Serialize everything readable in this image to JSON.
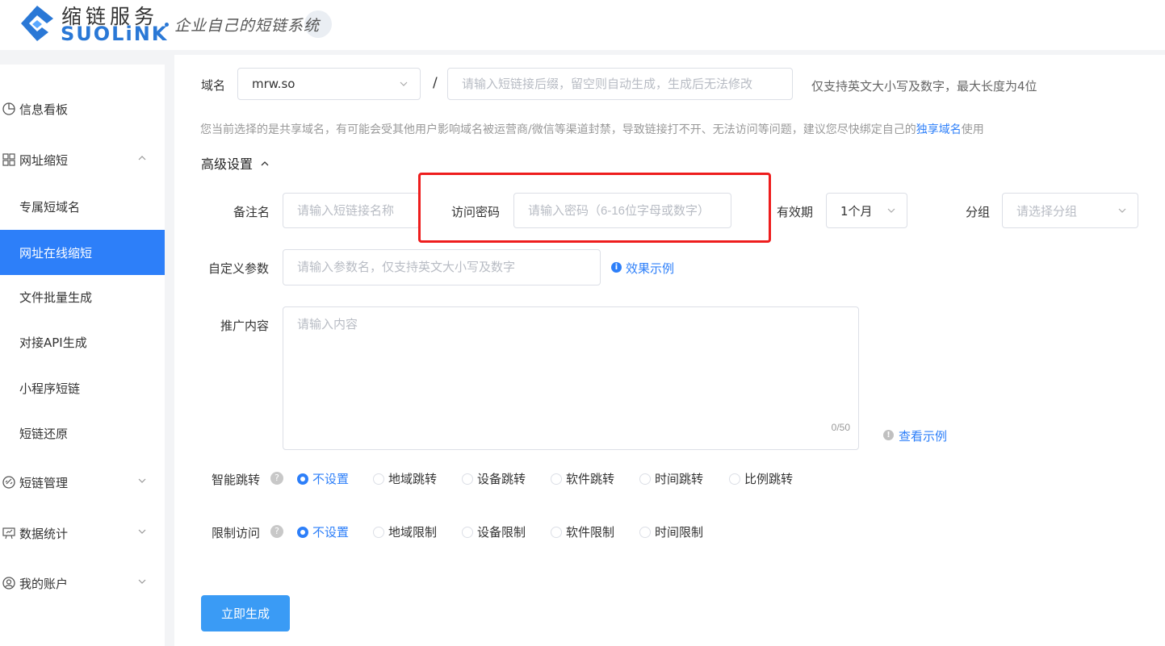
{
  "brand": {
    "name_cn": "缩链服务",
    "name_en": "SUOLiNK",
    "slogan": "企业自己的短链系统"
  },
  "sidebar": {
    "items": [
      {
        "label": "信息看板",
        "icon": "pie-chart-icon"
      },
      {
        "label": "网址缩短",
        "icon": "grid-icon",
        "expanded": true
      },
      {
        "label": "专属短域名"
      },
      {
        "label": "网址在线缩短",
        "active": true
      },
      {
        "label": "文件批量生成"
      },
      {
        "label": "对接API生成"
      },
      {
        "label": "小程序短链"
      },
      {
        "label": "短链还原"
      },
      {
        "label": "短链管理",
        "icon": "link-icon",
        "expanded": false
      },
      {
        "label": "数据统计",
        "icon": "presentation-icon",
        "expanded": false
      },
      {
        "label": "我的账户",
        "icon": "user-circle-icon",
        "expanded": false
      }
    ]
  },
  "form": {
    "domain_label": "域名",
    "domain_value": "mrw.so",
    "slash": "/",
    "suffix_placeholder": "请输入短链接后缀，留空则自动生成，生成后无法修改",
    "suffix_hint": "仅支持英文大小写及数字，最大长度为4位",
    "notice_text": "您当前选择的是共享域名，有可能会受其他用户影响域名被运营商/微信等渠道封禁，导致链接打不开、无法访问等问题，建议您尽快绑定自己的",
    "notice_link": "独享域名",
    "notice_tail": "使用",
    "advanced_label": "高级设置",
    "remark_label": "备注名",
    "remark_placeholder": "请输入短链接名称",
    "password_label": "访问密码",
    "password_placeholder": "请输入密码（6-16位字母或数字）",
    "validity_label": "有效期",
    "validity_value": "1个月",
    "group_label": "分组",
    "group_placeholder": "请选择分组",
    "param_label": "自定义参数",
    "param_placeholder": "请输入参数名，仅支持英文大小写及数字",
    "param_example_link": "效果示例",
    "promo_label": "推广内容",
    "promo_placeholder": "请输入内容",
    "promo_counter": "0/50",
    "promo_example_link": "查看示例",
    "smart_jump_label": "智能跳转",
    "smart_jump_options": [
      "不设置",
      "地域跳转",
      "设备跳转",
      "软件跳转",
      "时间跳转",
      "比例跳转"
    ],
    "smart_jump_selected": 0,
    "limit_label": "限制访问",
    "limit_options": [
      "不设置",
      "地域限制",
      "设备限制",
      "软件限制",
      "时间限制"
    ],
    "limit_selected": 0,
    "submit_label": "立即生成"
  },
  "colors": {
    "accent": "#2d7ff9",
    "button": "#3a9bf5",
    "highlight_frame": "#ee1d1d"
  }
}
